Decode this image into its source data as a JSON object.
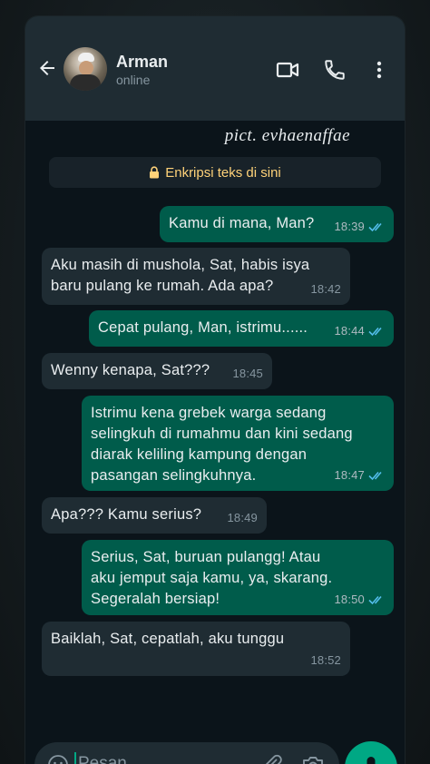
{
  "header": {
    "contact_name": "Arman",
    "contact_status": "online"
  },
  "watermark": "pict. evhaenaffae",
  "encryption_notice": "Enkripsi teks di sini",
  "messages": [
    {
      "dir": "out",
      "text": "Kamu di mana, Man?",
      "time": "18:39",
      "read": true
    },
    {
      "dir": "in",
      "text": "Aku masih di mushola, Sat, habis isya\nbaru pulang ke rumah. Ada apa?",
      "time": "18:42"
    },
    {
      "dir": "out",
      "text": "Cepat pulang, Man, istrimu......",
      "time": "18:44",
      "read": true
    },
    {
      "dir": "in",
      "text": "Wenny kenapa, Sat???",
      "time": "18:45"
    },
    {
      "dir": "out",
      "text": "Istrimu kena grebek warga sedang\nselingkuh di rumahmu dan kini sedang\ndiarak keliling kampung dengan\npasangan selingkuhnya.",
      "time": "18:47",
      "read": true
    },
    {
      "dir": "in",
      "text": "Apa??? Kamu serius?",
      "time": "18:49"
    },
    {
      "dir": "out",
      "text": "Serius, Sat, buruan pulangg! Atau\naku jemput saja kamu, ya, skarang.\nSegeralah bersiap!",
      "time": "18:50",
      "read": true
    },
    {
      "dir": "in",
      "text": "Baiklah, Sat, cepatlah, aku tunggu",
      "time": "18:52"
    }
  ],
  "composer": {
    "placeholder": "Pesan"
  },
  "icons": {
    "back": "arrow-left-icon",
    "video": "video-call-icon",
    "call": "phone-icon",
    "more": "more-vertical-icon",
    "lock": "lock-icon",
    "emoji": "emoji-icon",
    "attach": "paperclip-icon",
    "camera": "camera-icon",
    "mic": "mic-icon"
  },
  "colors": {
    "header_bg": "#1f2c33",
    "chat_bg": "#0b141a",
    "outgoing_bubble": "#005c4b",
    "incoming_bubble": "#1f2c33",
    "accent": "#00a884",
    "read_ticks": "#53bdeb",
    "encryption_text": "#ffd279"
  }
}
